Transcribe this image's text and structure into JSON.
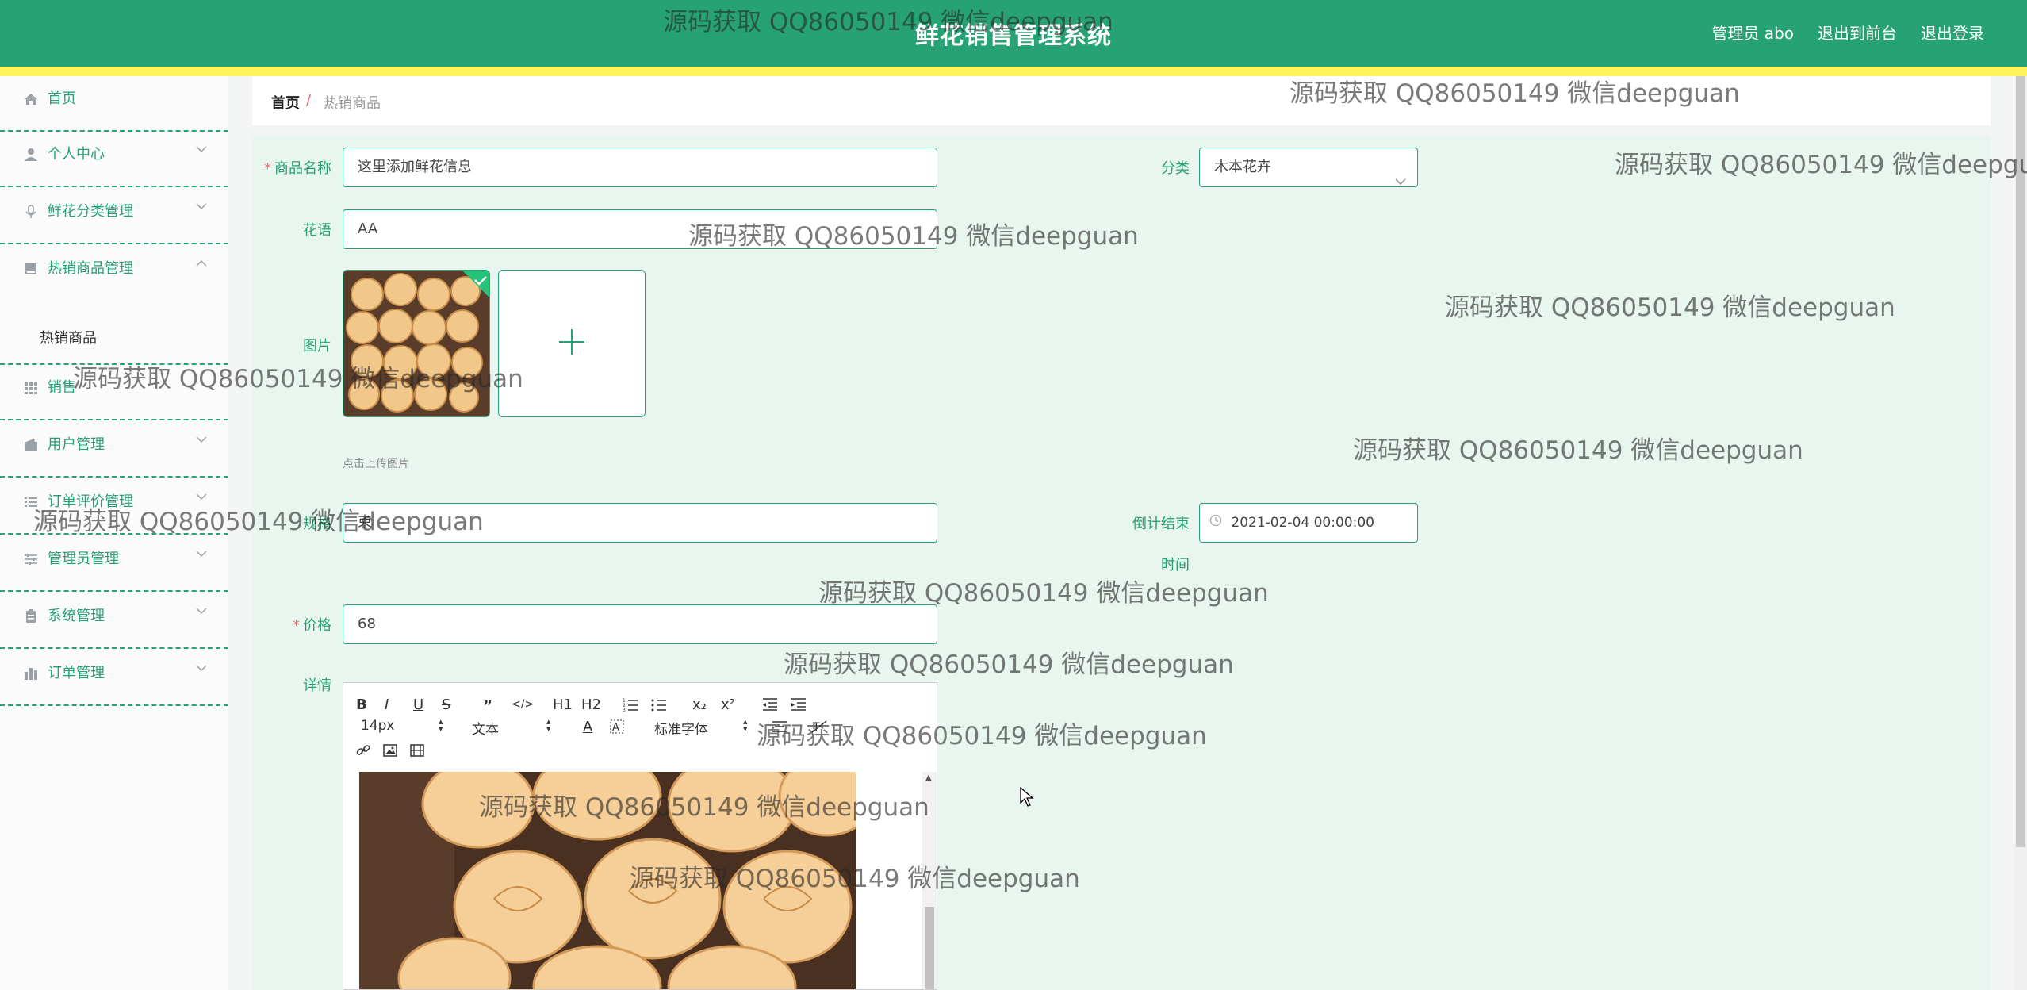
{
  "header": {
    "title": "鲜花销售管理系统",
    "admin_label": "管理员 abo",
    "exit_front": "退出到前台",
    "logout": "退出登录"
  },
  "sidebar": {
    "items": [
      {
        "label": "首页",
        "icon": "home-icon"
      },
      {
        "label": "个人中心",
        "icon": "user-icon"
      },
      {
        "label": "鲜花分类管理",
        "icon": "microphone-icon"
      },
      {
        "label": "热销商品管理",
        "icon": "book-icon"
      },
      {
        "label": "热销商品"
      },
      {
        "label": "销售",
        "icon": "grid-icon"
      },
      {
        "label": "用户管理",
        "icon": "wallet-icon"
      },
      {
        "label": "订单评价管理",
        "icon": "list-icon"
      },
      {
        "label": "管理员管理",
        "icon": "sliders-icon"
      },
      {
        "label": "系统管理",
        "icon": "clipboard-icon"
      },
      {
        "label": "订单管理",
        "icon": "chart-icon"
      }
    ]
  },
  "breadcrumb": {
    "home": "首页",
    "separator": "/",
    "current": "热销商品"
  },
  "form": {
    "name_label": "商品名称",
    "name_value": "这里添加鲜花信息",
    "category_label": "分类",
    "category_value": "木本花卉",
    "flower_lang_label": "花语",
    "flower_lang_value": "AA",
    "image_label": "图片",
    "upload_hint": "点击上传图片",
    "spec_label": "规格",
    "spec_value": "束",
    "countdown_label_1": "倒计结束",
    "countdown_label_2": "时间",
    "countdown_value": "2021-02-04 00:00:00",
    "price_label": "价格",
    "price_value": "68",
    "detail_label": "详情"
  },
  "editor": {
    "font_size": "14px",
    "text_style": "文本",
    "font_family": "标准字体",
    "buttons": [
      "B",
      "I",
      "U",
      "S",
      "”",
      "</>",
      "H1",
      "H2",
      "ordered-list",
      "bullet-list",
      "x₂",
      "x²",
      "outdent",
      "indent",
      "A",
      "highlight",
      "align",
      "clear-format",
      "link",
      "image",
      "video"
    ]
  },
  "watermark": "源码获取 QQ86050149 微信deepguan",
  "colors": {
    "primary": "#27a275",
    "accent_stripe": "#fff25a",
    "panel": "#e9f6f0",
    "required": "#f56c6c"
  }
}
